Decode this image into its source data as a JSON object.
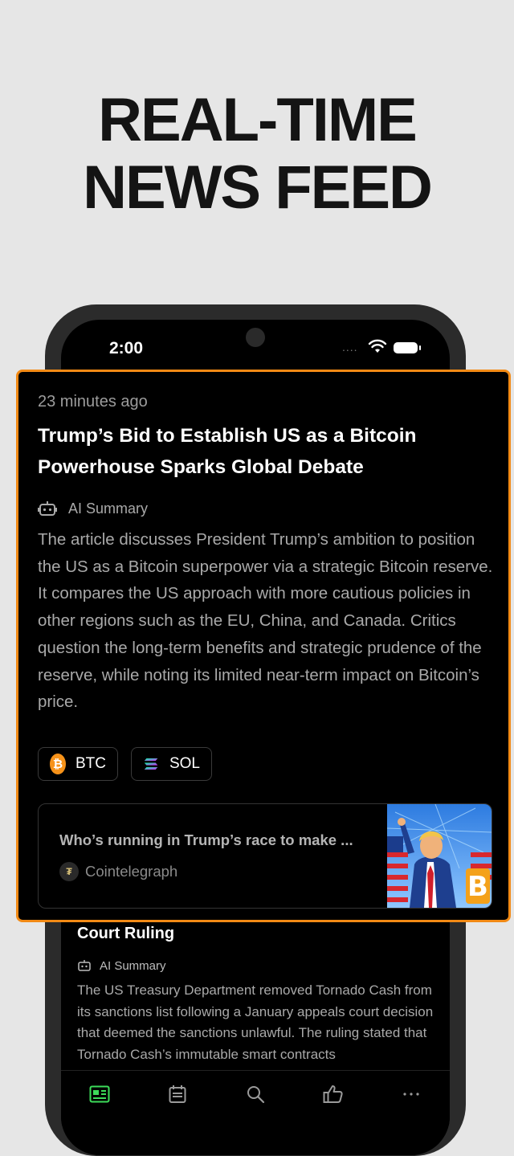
{
  "headline": {
    "line1": "REAL-TIME",
    "line2": "NEWS FEED"
  },
  "status_bar": {
    "time": "2:00",
    "signal_dots": "....",
    "wifi_icon": "wifi-icon",
    "battery_icon": "battery-icon"
  },
  "card": {
    "time_ago": "23 minutes ago",
    "title": "Trump’s Bid to Establish US as a Bitcoin Powerhouse Sparks Global Debate",
    "ai_label": "AI Summary",
    "summary": "The article discusses President Trump’s ambition to position the US as a Bitcoin superpower via a strategic Bitcoin reserve. It compares the US approach with more cautious policies in other regions such as the EU, China, and Canada. Critics question the long-term benefits and strategic prudence of the reserve, while noting its limited near-term impact on Bitcoin’s price.",
    "tags": [
      {
        "label": "BTC",
        "icon": "bitcoin-icon",
        "color": "#f7931a",
        "symbol": "₿"
      },
      {
        "label": "SOL",
        "icon": "solana-icon"
      }
    ],
    "related": {
      "title": "Who’s running in Trump’s race to make ...",
      "source": "Cointelegraph"
    }
  },
  "next_item": {
    "title_tail": "Court Ruling",
    "ai_label": "AI Summary",
    "summary": "The US Treasury Department removed Tornado Cash from its sanctions list following a January appeals court decision that deemed the sanctions unlawful. The ruling stated that Tornado Cash’s immutable smart contracts"
  },
  "tabbar": {
    "items": [
      {
        "icon": "news-icon",
        "active": true
      },
      {
        "icon": "calendar-icon",
        "active": false
      },
      {
        "icon": "search-icon",
        "active": false
      },
      {
        "icon": "thumbs-up-icon",
        "active": false
      },
      {
        "icon": "more-icon",
        "active": false
      }
    ],
    "active_color": "#3ddc5a"
  },
  "colors": {
    "accent_border": "#f28a15",
    "background": "#e6e6e6"
  }
}
